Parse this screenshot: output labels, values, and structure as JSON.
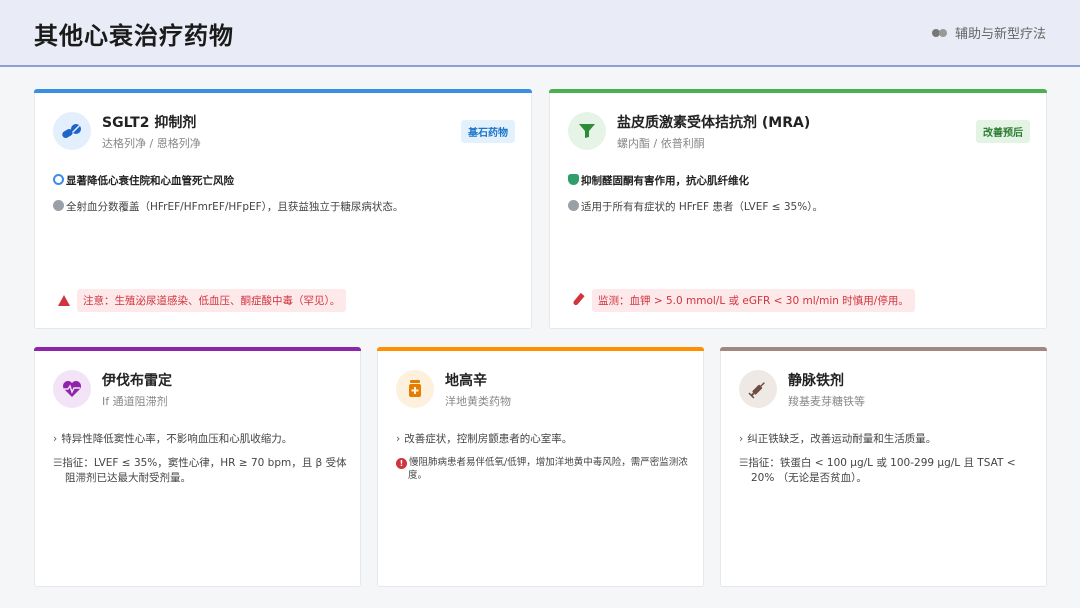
{
  "header": {
    "title": "其他心衰治疗药物",
    "tag": "辅助与新型疗法",
    "tag_icon": "pills-icon"
  },
  "cards": {
    "sglt2": {
      "color": "#3a8ee6",
      "icon": "pills-icon",
      "name": "SGLT2 抑制剂",
      "sub": "达格列净 / 恩格列净",
      "badge": "基石药物",
      "point1": "显著降低心衰住院和心血管死亡风险",
      "point2": "全射血分数覆盖（HFrEF/HFmrEF/HFpEF），且获益独立于糖尿病状态。",
      "warning": "注意：生殖泌尿道感染、低血压、酮症酸中毒（罕见）。"
    },
    "mra": {
      "color": "#4caf50",
      "icon": "filter-icon",
      "name": "盐皮质激素受体拮抗剂 (MRA)",
      "sub": "螺内酯 / 依普利酮",
      "badge": "改善预后",
      "point1": "抑制醛固酮有害作用，抗心肌纤维化",
      "point2": "适用于所有有症状的 HFrEF 患者（LVEF ≤ 35%）。",
      "warning": "监测：血钾 > 5.0 mmol/L 或 eGFR < 30 ml/min 时慎用/停用。"
    },
    "ivabradine": {
      "color": "#8e24aa",
      "icon": "heartbeat-icon",
      "name": "伊伐布雷定",
      "sub": "If 通道阻滞剂",
      "point1": "特异性降低窦性心率，不影响血压和心肌收缩力。",
      "point2": "指征：LVEF ≤ 35%，窦性心律，HR ≥ 70 bpm，且 β 受体阻滞剂已达最大耐受剂量。"
    },
    "digoxin": {
      "color": "#ff8f00",
      "icon": "medicine-bottle-icon",
      "name": "地高辛",
      "sub": "洋地黄类药物",
      "point1": "改善症状，控制房颤患者的心室率。",
      "point2": "慢阻肺病患者易伴低氧/低钾，增加洋地黄中毒风险，需严密监测浓度。"
    },
    "iron": {
      "color": "#a1887f",
      "icon": "syringe-icon",
      "name": "静脉铁剂",
      "sub": "羧基麦芽糖铁等",
      "point1": "纠正铁缺乏，改善运动耐量和生活质量。",
      "point2": "指征：铁蛋白 < 100 μg/L 或 100-299 μg/L 且 TSAT < 20% （无论是否贫血）。"
    }
  }
}
